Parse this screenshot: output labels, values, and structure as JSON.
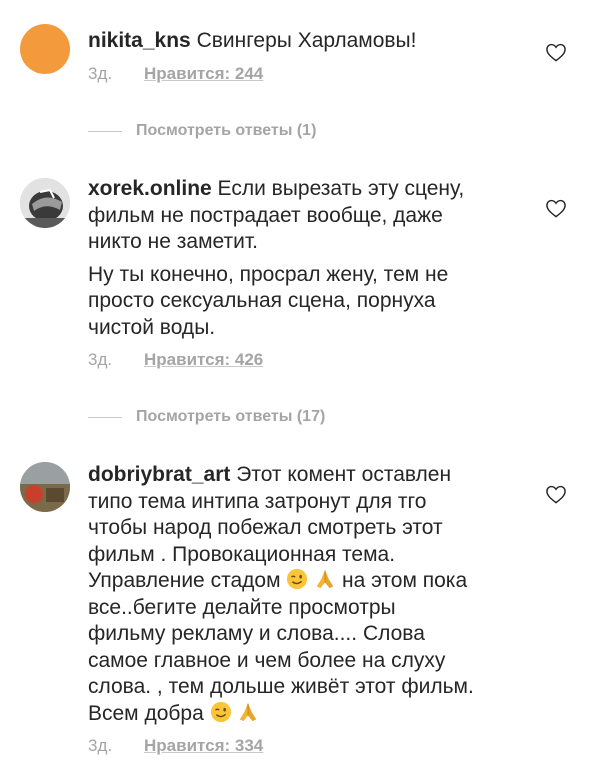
{
  "comments": [
    {
      "username": "nikita_kns",
      "text": "Свингеры Харламовы!",
      "time": "3д.",
      "likes": "Нравится: 244",
      "replies": "Посмотреть ответы (1)",
      "avatar_color": "#f39a3c"
    },
    {
      "username": "xorek.online",
      "text": "Если вырезать эту сцену,",
      "lines": [
        "фильм не пострадает вообще, даже",
        "никто не заметит."
      ],
      "para2": [
        "Ну ты конечно, просрал жену, тем не",
        "просто сексуальная сцена, порнуха",
        "чистой воды."
      ],
      "time": "3д.",
      "likes": "Нравится: 426",
      "replies": "Посмотреть ответы (17)"
    },
    {
      "username": "dobriybrat_art",
      "text": "Этот комент оставлен",
      "lines": [
        "типо тема интипа затронут для тго",
        "чтобы народ побежал смотреть этот",
        "фильм . Провокационная тема."
      ],
      "line_emoji_1_before": "Управление стадом",
      "line_emoji_1_after": "на этом пока",
      "lines2": [
        "все..бегите делайте просмотры",
        "фильму рекламу и слова.... Слова",
        "самое главное и чем более на слуху",
        "слова. , тем дольше живёт этот фильм."
      ],
      "last_line": "Всем добра",
      "time": "3д.",
      "likes": "Нравится: 334"
    }
  ],
  "icons": {
    "like": "heart-outline-icon",
    "wink": "winking-face-emoji",
    "pray": "folded-hands-emoji"
  }
}
